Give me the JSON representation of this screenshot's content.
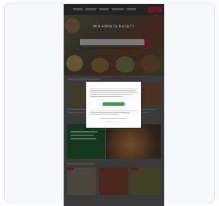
{
  "page": {
    "hero_title": "MIN FÖRSTE RECETT",
    "dialog": {
      "title": "",
      "accept_label": ""
    },
    "colors": {
      "brand_red": "#b2283a",
      "accept_green": "#3f9e4d",
      "promo_green": "#1f5b2f",
      "overlay": "rgba(0,0,0,0.38)"
    }
  }
}
